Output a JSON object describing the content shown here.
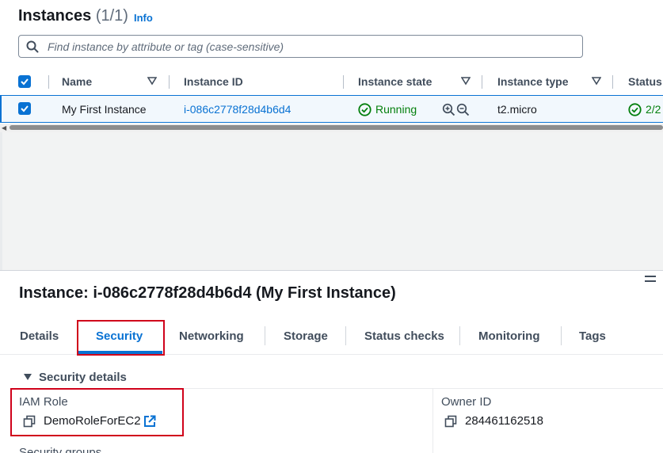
{
  "header": {
    "title": "Instances",
    "count": "(1/1)",
    "info_link": "Info"
  },
  "search": {
    "placeholder": "Find instance by attribute or tag (case-sensitive)"
  },
  "table": {
    "columns": [
      "Name",
      "Instance ID",
      "Instance state",
      "Instance type",
      "Status"
    ],
    "row": {
      "name": "My First Instance",
      "instance_id": "i-086c2778f28d4b6d4",
      "state": "Running",
      "type": "t2.micro",
      "status_check": "2/2"
    }
  },
  "details": {
    "title": "Instance: i-086c2778f28d4b6d4 (My First Instance)",
    "tabs": [
      "Details",
      "Security",
      "Networking",
      "Storage",
      "Status checks",
      "Monitoring",
      "Tags"
    ],
    "active_tab": "Security",
    "section_title": "Security details",
    "iam_role_label": "IAM Role",
    "iam_role_value": "DemoRoleForEC2",
    "owner_id_label": "Owner ID",
    "owner_id_value": "284461162518",
    "security_groups_label": "Security groups"
  },
  "colors": {
    "accent": "#0972d3",
    "running": "#037f0c",
    "highlight_box": "#d0021b"
  }
}
